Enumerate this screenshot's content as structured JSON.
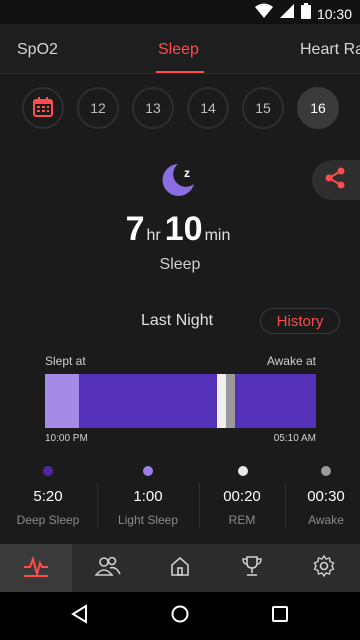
{
  "status_bar": {
    "time": "10:30"
  },
  "tabs": [
    {
      "label": "SpO2"
    },
    {
      "label": "Sleep"
    },
    {
      "label": "Heart Ra"
    }
  ],
  "days": [
    "12",
    "13",
    "14",
    "15",
    "16"
  ],
  "selected_day": "16",
  "summary": {
    "hours": "7",
    "hours_unit": "hr",
    "minutes": "10",
    "minutes_unit": "min",
    "label": "Sleep"
  },
  "range": {
    "label": "Last Night",
    "history_label": "History"
  },
  "timeline": {
    "slept_label": "Slept at",
    "awake_label": "Awake at",
    "start_time": "10:00 PM",
    "end_time": "05:10 AM"
  },
  "stats": [
    {
      "value": "5:20",
      "label": "Deep Sleep",
      "color": "#4b2aa0"
    },
    {
      "value": "1:00",
      "label": "Light Sleep",
      "color": "#9d80e6"
    },
    {
      "value": "00:20",
      "label": "REM",
      "color": "#e9e9e9"
    },
    {
      "value": "00:30",
      "label": "Awake",
      "color": "#9a9a9a"
    }
  ],
  "colors": {
    "accent": "#ff4c4c",
    "deep": "#5530b8",
    "light": "#a58be6",
    "rem": "#f0f0f0",
    "awake": "#9a9a9a"
  }
}
